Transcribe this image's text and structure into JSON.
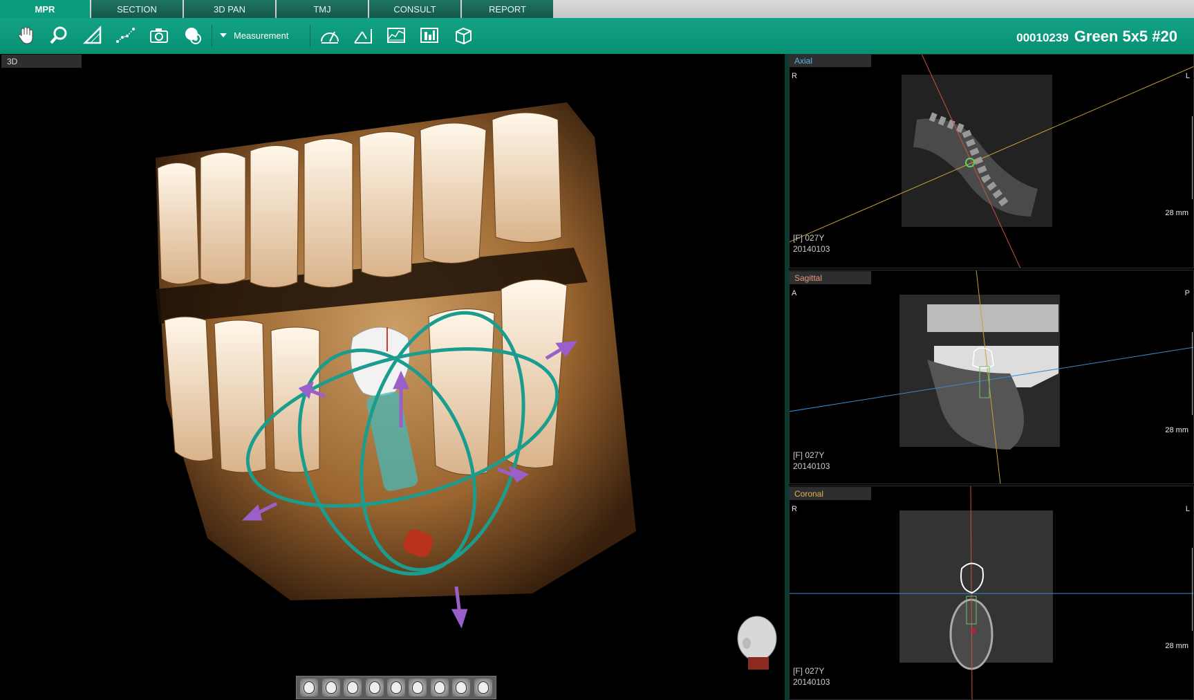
{
  "tabs": [
    "MPR",
    "SECTION",
    "3D PAN",
    "TMJ",
    "CONSULT",
    "REPORT"
  ],
  "active_tab": "MPR",
  "toolbar": {
    "tools_left": [
      "pan-hand-icon",
      "zoom-magnifier-icon",
      "angle-ruler-icon",
      "polyline-measure-icon",
      "camera-capture-icon",
      "reset-view-icon"
    ],
    "measurement_label": "Measurement",
    "tools_right": [
      "density-gauge-icon",
      "angle-measure-icon",
      "profile-chart-icon",
      "histogram-window-icon",
      "cube-volume-icon"
    ]
  },
  "patient": {
    "id": "00010239",
    "name": "Green 5x5 #20"
  },
  "main_view": {
    "label": "3D"
  },
  "view_buttons": [
    "view-front-icon",
    "view-left-icon",
    "view-right-icon",
    "view-left-oblique-icon",
    "view-right-oblique-icon",
    "view-top-icon",
    "view-bottom-icon",
    "view-back-icon",
    "view-rotate-icon"
  ],
  "axial": {
    "label": "Axial",
    "left": "R",
    "right": "L",
    "scale": "28 mm",
    "info1": "[F] 027Y",
    "info2": "20140103"
  },
  "sagittal": {
    "label": "Sagittal",
    "left": "A",
    "right": "P",
    "scale": "28 mm",
    "info1": "[F] 027Y",
    "info2": "20140103"
  },
  "coronal": {
    "label": "Coronal",
    "left": "R",
    "right": "L",
    "scale": "28 mm",
    "info1": "[F] 027Y",
    "info2": "20140103"
  },
  "colors": {
    "brand": "#079073",
    "tab": "#14584a",
    "axial_tag": "#5ab3e4",
    "sagittal_tag": "#e59a7d",
    "coronal_tag": "#e5b34a"
  }
}
